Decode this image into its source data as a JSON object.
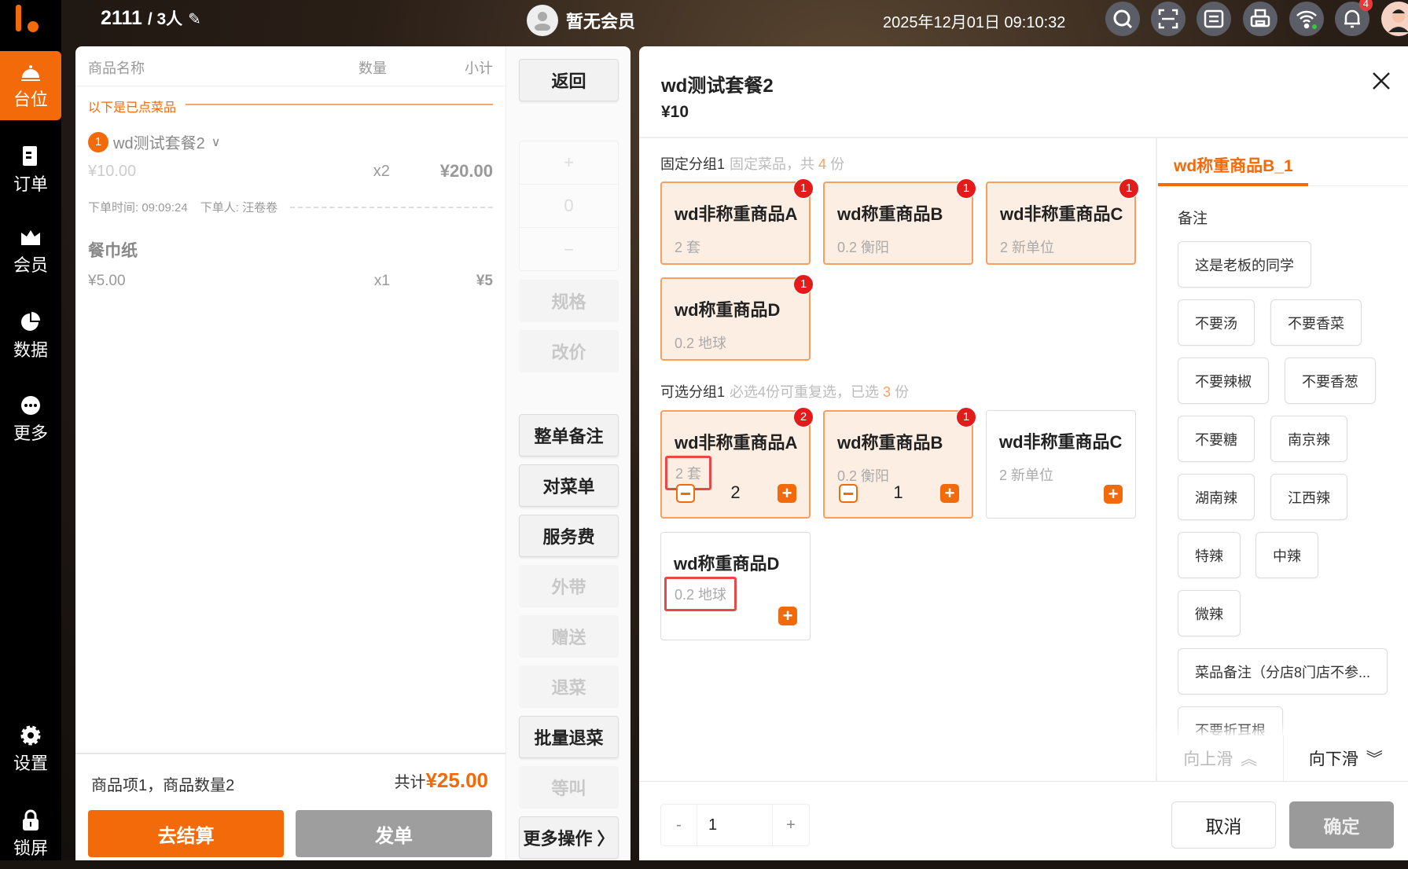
{
  "sidebar": {
    "items": [
      {
        "label": "台位",
        "icon": "bell-icon",
        "active": true
      },
      {
        "label": "订单",
        "icon": "order-icon"
      },
      {
        "label": "会员",
        "icon": "crown-icon"
      },
      {
        "label": "数据",
        "icon": "pie-chart-icon"
      },
      {
        "label": "更多",
        "icon": "more-icon"
      },
      {
        "label": "设置",
        "icon": "gear-icon"
      },
      {
        "label": "锁屏",
        "icon": "lock-icon"
      }
    ]
  },
  "topbar": {
    "table": "2111",
    "guests": "/ 3人",
    "member": "暂无会员",
    "datetime": "2025年12月01日 09:10:32",
    "notification_count": "4"
  },
  "order": {
    "headers": {
      "name": "商品名称",
      "qty": "数量",
      "subtotal": "小计"
    },
    "ordered_label": "以下是已点菜品",
    "items": [
      {
        "index": "1",
        "name": "wd测试套餐2",
        "price": "¥10.00",
        "qty": "x2",
        "subtotal": "¥20.00",
        "order_time": "下单时间: 09:09:24",
        "orderer": "下单人: 汪卷卷"
      },
      {
        "name": "餐巾纸",
        "price": "¥5.00",
        "qty": "x1",
        "subtotal": "¥5"
      }
    ],
    "summary": "商品项1，商品数量2",
    "total_label": "共计",
    "total": "¥25.00",
    "checkout": "去结算",
    "send": "发单"
  },
  "actions": {
    "back": "返回",
    "stepper_plus": "+",
    "stepper_value": "0",
    "stepper_minus": "−",
    "buttons": [
      {
        "label": "规格",
        "enabled": false
      },
      {
        "label": "改价",
        "enabled": false
      },
      {
        "label": "整单备注",
        "enabled": true
      },
      {
        "label": "对菜单",
        "enabled": true
      },
      {
        "label": "服务费",
        "enabled": true
      },
      {
        "label": "外带",
        "enabled": false
      },
      {
        "label": "赠送",
        "enabled": false
      },
      {
        "label": "退菜",
        "enabled": false
      },
      {
        "label": "批量退菜",
        "enabled": true
      },
      {
        "label": "等叫",
        "enabled": false
      },
      {
        "label": "更多操作 〉",
        "enabled": true
      }
    ]
  },
  "modal": {
    "title": "wd测试套餐2",
    "price": "¥10",
    "fixed_group": {
      "name": "固定分组1",
      "hint_pre": "固定菜品，共",
      "hint_num": "4",
      "hint_post": "份",
      "items": [
        {
          "name": "wd非称重商品A",
          "spec": "2 套",
          "badge": "1"
        },
        {
          "name": "wd称重商品B",
          "spec": "0.2 衡阳",
          "badge": "1"
        },
        {
          "name": "wd非称重商品C",
          "spec": "2 新单位",
          "badge": "1"
        },
        {
          "name": "wd称重商品D",
          "spec": "0.2 地球",
          "badge": "1"
        }
      ]
    },
    "optional_group": {
      "name": "可选分组1",
      "hint_pre": "必选4份可重复选，已选",
      "hint_num": "3",
      "hint_post": "份",
      "items": [
        {
          "name": "wd非称重商品A",
          "spec": "2 套",
          "badge": "2",
          "qty": "2",
          "selected": true,
          "highlight": true
        },
        {
          "name": "wd称重商品B",
          "spec": "0.2 衡阳",
          "badge": "1",
          "qty": "1",
          "selected": true
        },
        {
          "name": "wd非称重商品C",
          "spec": "2 新单位"
        },
        {
          "name": "wd称重商品D",
          "spec": "0.2 地球",
          "highlight": true
        }
      ]
    },
    "notes_tab": "wd称重商品B_1",
    "notes_label": "备注",
    "chips": [
      [
        "这是老板的同学"
      ],
      [
        "不要汤",
        "不要香菜"
      ],
      [
        "不要辣椒",
        "不要香葱"
      ],
      [
        "不要糖",
        "南京辣"
      ],
      [
        "湖南辣",
        "江西辣"
      ],
      [
        "特辣",
        "中辣"
      ],
      [
        "微辣"
      ],
      [
        "菜品备注（分店8门店不参..."
      ],
      [
        "不要折耳根"
      ]
    ],
    "scroll_up": "向上滑",
    "scroll_down": "向下滑",
    "quantity": "1",
    "qty_minus": "-",
    "qty_plus": "+",
    "cancel": "取消",
    "confirm": "确定"
  },
  "colors": {
    "accent": "#f26a0a",
    "badge": "#e21b1b"
  }
}
